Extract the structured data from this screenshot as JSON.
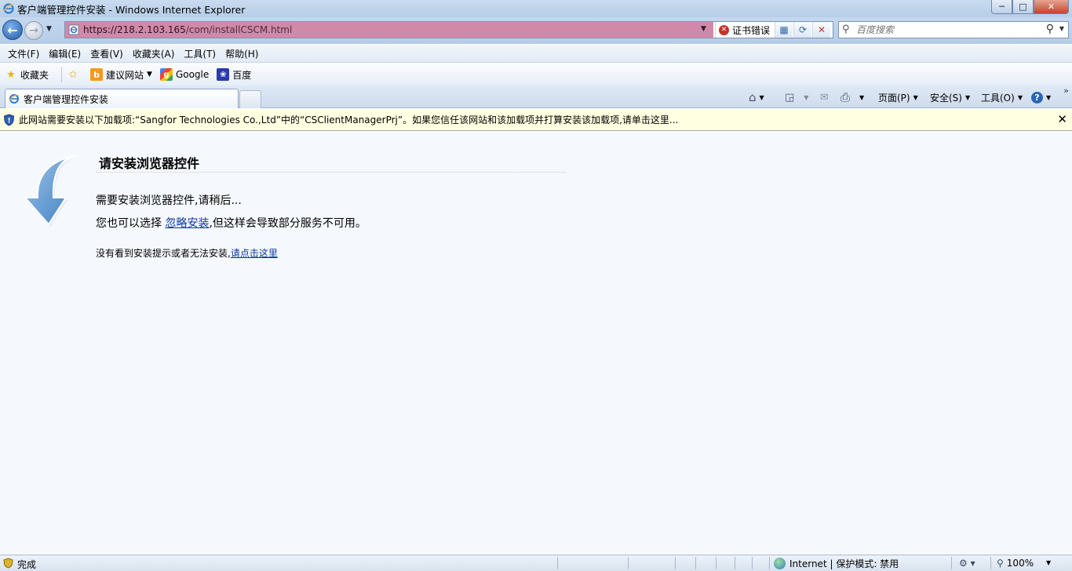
{
  "window": {
    "title": "客户端管理控件安装 - Windows Internet Explorer",
    "buttons": {
      "minimize": "─",
      "maximize": "□",
      "close": "✕"
    }
  },
  "address_bar": {
    "url_host": "https://218.2.103.165",
    "url_path": "/com/installCSCM.html",
    "cert_error": "证书错误"
  },
  "search": {
    "placeholder": "百度搜索"
  },
  "menu": {
    "items": [
      "文件(F)",
      "编辑(E)",
      "查看(V)",
      "收藏夹(A)",
      "工具(T)",
      "帮助(H)"
    ]
  },
  "favorites": {
    "label": "收藏夹",
    "items": [
      "建议网站",
      "Google",
      "百度"
    ]
  },
  "tab": {
    "title": "客户端管理控件安装"
  },
  "command_bar": {
    "page": "页面(P)",
    "safety": "安全(S)",
    "tools": "工具(O)",
    "chevron": "»"
  },
  "infobar": {
    "message": "此网站需要安装以下加载项:“Sangfor Technologies Co.,Ltd”中的“CSClientManagerPrj”。如果您信任该网站和该加载项并打算安装该加载项,请单击这里..."
  },
  "content": {
    "heading": "请安装浏览器控件",
    "line1": "需要安装浏览器控件,请稍后...",
    "line2_prefix": "您也可以选择",
    "line2_link": "忽略安装",
    "line2_suffix": ",但这样会导致部分服务不可用。",
    "line3_prefix": "没有看到安装提示或者无法安装,",
    "line3_link": "请点击这里"
  },
  "status": {
    "text": "完成",
    "zone": "Internet | 保护模式: 禁用",
    "zoom": "100%"
  },
  "colors": {
    "address_fill": "#d189aa",
    "infobar_bg": "#ffffe1",
    "link": "#0a37a0",
    "content_bg": "#f5f8fc"
  }
}
